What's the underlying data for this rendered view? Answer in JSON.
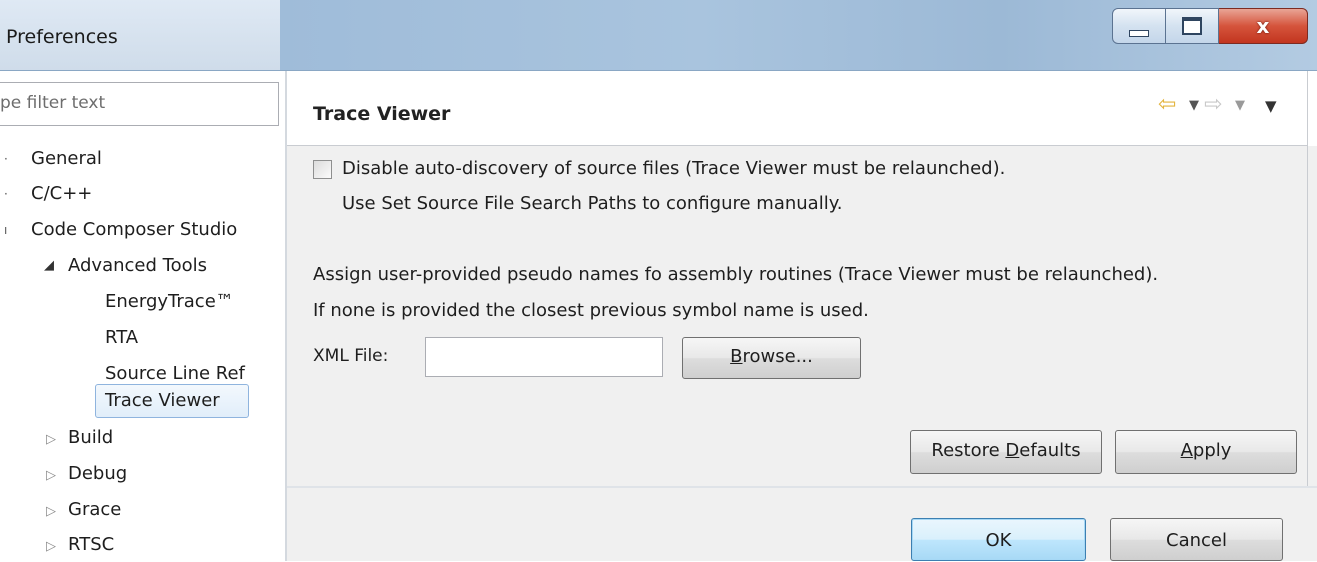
{
  "window": {
    "title": "Preferences",
    "minimize_glyph": "minimize-icon",
    "maximize_glyph": "maximize-icon",
    "close_label": "x",
    "accent": "#c2351f"
  },
  "sidebar": {
    "filter_placeholder": "pe filter text",
    "items": [
      {
        "label": "General"
      },
      {
        "label": "C/C++"
      },
      {
        "label": "Code Composer Studio"
      },
      {
        "label": "Advanced Tools"
      },
      {
        "label": "EnergyTrace™"
      },
      {
        "label": "RTA"
      },
      {
        "label": "Source Line Ref"
      },
      {
        "label": "Trace Viewer"
      },
      {
        "label": "Build"
      },
      {
        "label": "Debug"
      },
      {
        "label": "Grace"
      },
      {
        "label": "RTSC"
      }
    ]
  },
  "page": {
    "title": "Trace Viewer",
    "nav_back_icon": "back-arrow-icon",
    "nav_forward_icon": "forward-arrow-icon",
    "checkbox_line1": "Disable auto-discovery of source files (Trace Viewer must be relaunched).",
    "checkbox_line2": "Use Set Source File Search Paths to configure manually.",
    "checkbox_checked": false,
    "assign_line1": "Assign user-provided pseudo names fo assembly routines (Trace Viewer must be relaunched).",
    "assign_line2": "If none is provided the closest previous symbol name is used.",
    "xml_label": "XML File:",
    "xml_value": "",
    "browse": {
      "pre": "",
      "mnemonic": "B",
      "post": "rowse..."
    },
    "restore": {
      "pre": "Restore ",
      "mnemonic": "D",
      "post": "efaults"
    },
    "apply": {
      "pre": "",
      "mnemonic": "A",
      "post": "pply"
    }
  },
  "footer": {
    "ok_label": "OK",
    "cancel_label": "Cancel"
  }
}
